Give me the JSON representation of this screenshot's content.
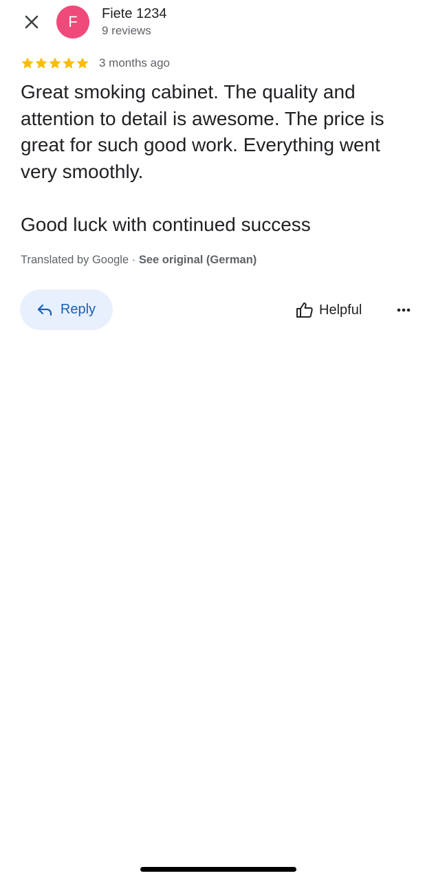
{
  "colors": {
    "avatar_bg": "#ef4a7a",
    "star": "#fbbc04",
    "reply_bg": "#e8f0fe",
    "reply_text": "#1a5fb4",
    "secondary_text": "#5f6368"
  },
  "header": {
    "close_icon": "close-icon",
    "avatar_initial": "F",
    "reviewer_name": "Fiete 1234",
    "review_count": "9 reviews"
  },
  "review": {
    "rating": 5,
    "rating_max": 5,
    "date": "3 months ago",
    "text": "Great smoking cabinet. The quality and attention to detail is awesome. The price is great for such good work. Everything went very smoothly.\n\nGood luck with continued success",
    "translated_by": "Translated by Google · ",
    "see_original": "See original (German)"
  },
  "actions": {
    "reply_label": "Reply",
    "reply_icon": "reply-arrow-icon",
    "helpful_label": "Helpful",
    "helpful_icon": "thumbs-up-icon",
    "more_icon": "more-horizontal-icon"
  }
}
